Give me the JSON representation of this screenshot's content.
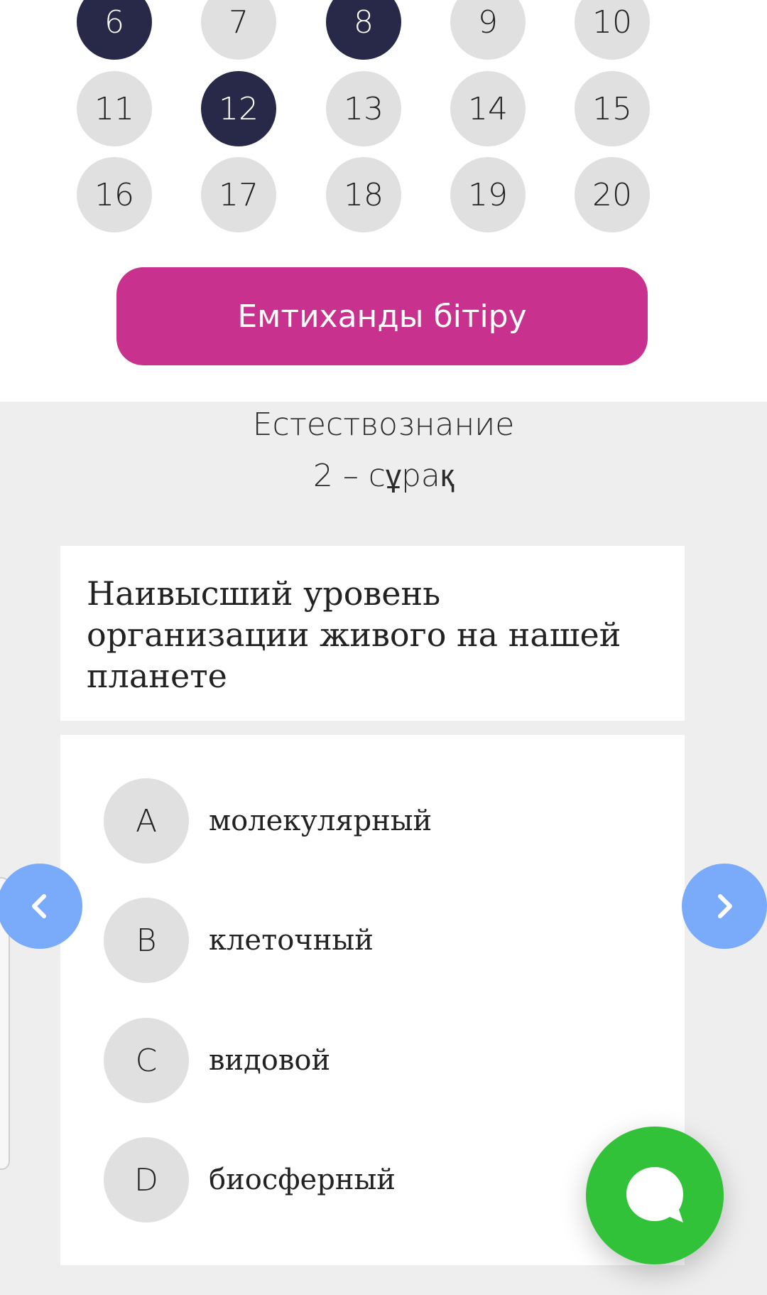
{
  "question_grid": {
    "items": [
      {
        "label": "6",
        "answered": true
      },
      {
        "label": "7",
        "answered": false
      },
      {
        "label": "8",
        "answered": true
      },
      {
        "label": "9",
        "answered": false
      },
      {
        "label": "10",
        "answered": false
      },
      {
        "label": "11",
        "answered": false
      },
      {
        "label": "12",
        "answered": true
      },
      {
        "label": "13",
        "answered": false
      },
      {
        "label": "14",
        "answered": false
      },
      {
        "label": "15",
        "answered": false
      },
      {
        "label": "16",
        "answered": false
      },
      {
        "label": "17",
        "answered": false
      },
      {
        "label": "18",
        "answered": false
      },
      {
        "label": "19",
        "answered": false
      },
      {
        "label": "20",
        "answered": false
      }
    ]
  },
  "finish_button": {
    "label": "Емтиханды бітіру"
  },
  "subject": "Естествознание",
  "question_number": "2 – сұрақ",
  "question": {
    "text": "Наивысший уровень организации живого на нашей планете"
  },
  "options": [
    {
      "letter": "A",
      "text": "молекулярный"
    },
    {
      "letter": "B",
      "text": "клеточный"
    },
    {
      "letter": "C",
      "text": "видовой"
    },
    {
      "letter": "D",
      "text": "биосферный"
    }
  ],
  "icons": {
    "prev": "chevron-left-icon",
    "next": "chevron-right-icon",
    "chat": "chat-bubble-icon"
  },
  "colors": {
    "answered": "#282848",
    "unanswered": "#e0e0e0",
    "finish_button": "#c8318d",
    "nav_button": "#7aabfb",
    "chat_button": "#32c23a",
    "panel_background": "#eeeeee"
  }
}
